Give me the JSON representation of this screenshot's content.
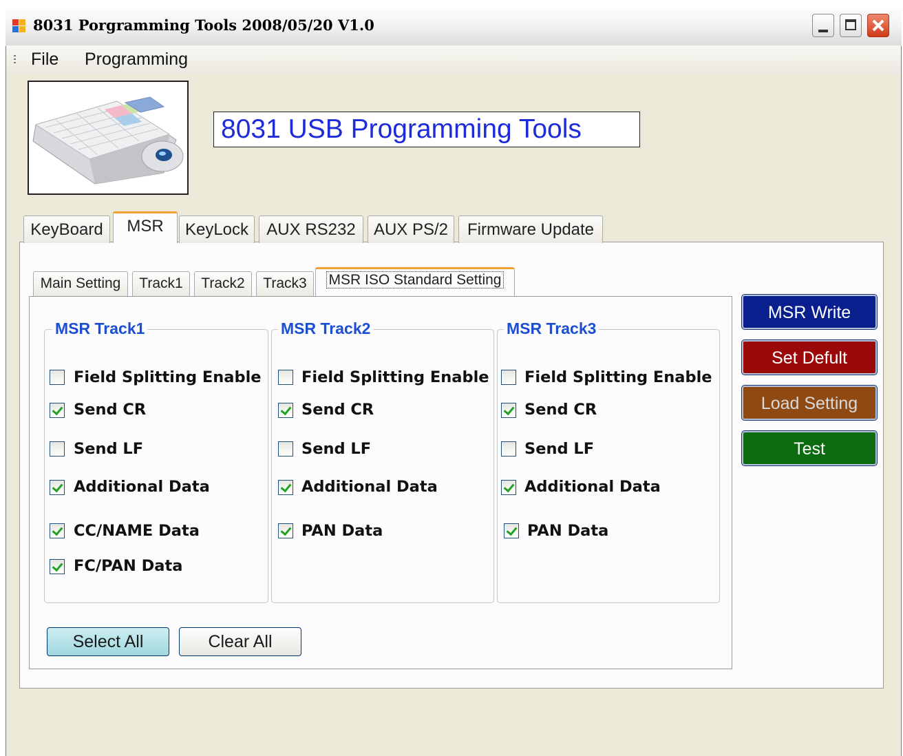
{
  "window": {
    "title": "8031 Porgramming Tools 2008/05/20 V1.0",
    "buttons": {
      "minimize": "minimize",
      "maximize": "maximize",
      "close": "close"
    }
  },
  "menu": [
    "File",
    "Programming"
  ],
  "header": {
    "banner": "8031 USB Programming Tools",
    "image_alt": "keyboard product image"
  },
  "tabs": [
    "KeyBoard",
    "MSR",
    "KeyLock",
    "AUX RS232",
    "AUX PS/2",
    "Firmware Update"
  ],
  "active_tab": "MSR",
  "subtabs": [
    "Main Setting",
    "Track1",
    "Track2",
    "Track3",
    "MSR ISO Standard Setting"
  ],
  "active_subtab": "MSR ISO Standard Setting",
  "groups": [
    {
      "title": "MSR Track1",
      "options": [
        {
          "label": "Field Splitting Enable",
          "checked": false
        },
        {
          "label": "Send CR",
          "checked": true
        },
        {
          "label": "Send LF",
          "checked": false
        },
        {
          "label": "Additional Data",
          "checked": true
        },
        {
          "label": "CC/NAME Data",
          "checked": true
        },
        {
          "label": "FC/PAN Data",
          "checked": true
        }
      ]
    },
    {
      "title": "MSR Track2",
      "options": [
        {
          "label": "Field Splitting Enable",
          "checked": false
        },
        {
          "label": "Send CR",
          "checked": true
        },
        {
          "label": "Send LF",
          "checked": false
        },
        {
          "label": "Additional Data",
          "checked": true
        },
        {
          "label": "PAN Data",
          "checked": true
        }
      ]
    },
    {
      "title": "MSR Track3",
      "options": [
        {
          "label": "Field Splitting Enable",
          "checked": false
        },
        {
          "label": "Send CR",
          "checked": true
        },
        {
          "label": "Send LF",
          "checked": false
        },
        {
          "label": "Additional Data",
          "checked": true
        },
        {
          "label": "PAN Data",
          "checked": true
        }
      ]
    }
  ],
  "bottom_buttons": {
    "select_all": "Select All",
    "clear_all": "Clear All"
  },
  "side_buttons": {
    "msr_write": "MSR Write",
    "set_default": "Set Defult",
    "load_setting": "Load Setting",
    "test": "Test"
  },
  "colors": {
    "banner_text": "#1d2bd8",
    "group_title": "#1b4fd1",
    "active_tab_accent": "#f2a032",
    "msr_write_bg": "#0a1f8e",
    "set_default_bg": "#9b0a0a",
    "load_setting_bg": "#8f4a14",
    "test_bg": "#0c6b0f",
    "check_mark": "#21a121"
  }
}
